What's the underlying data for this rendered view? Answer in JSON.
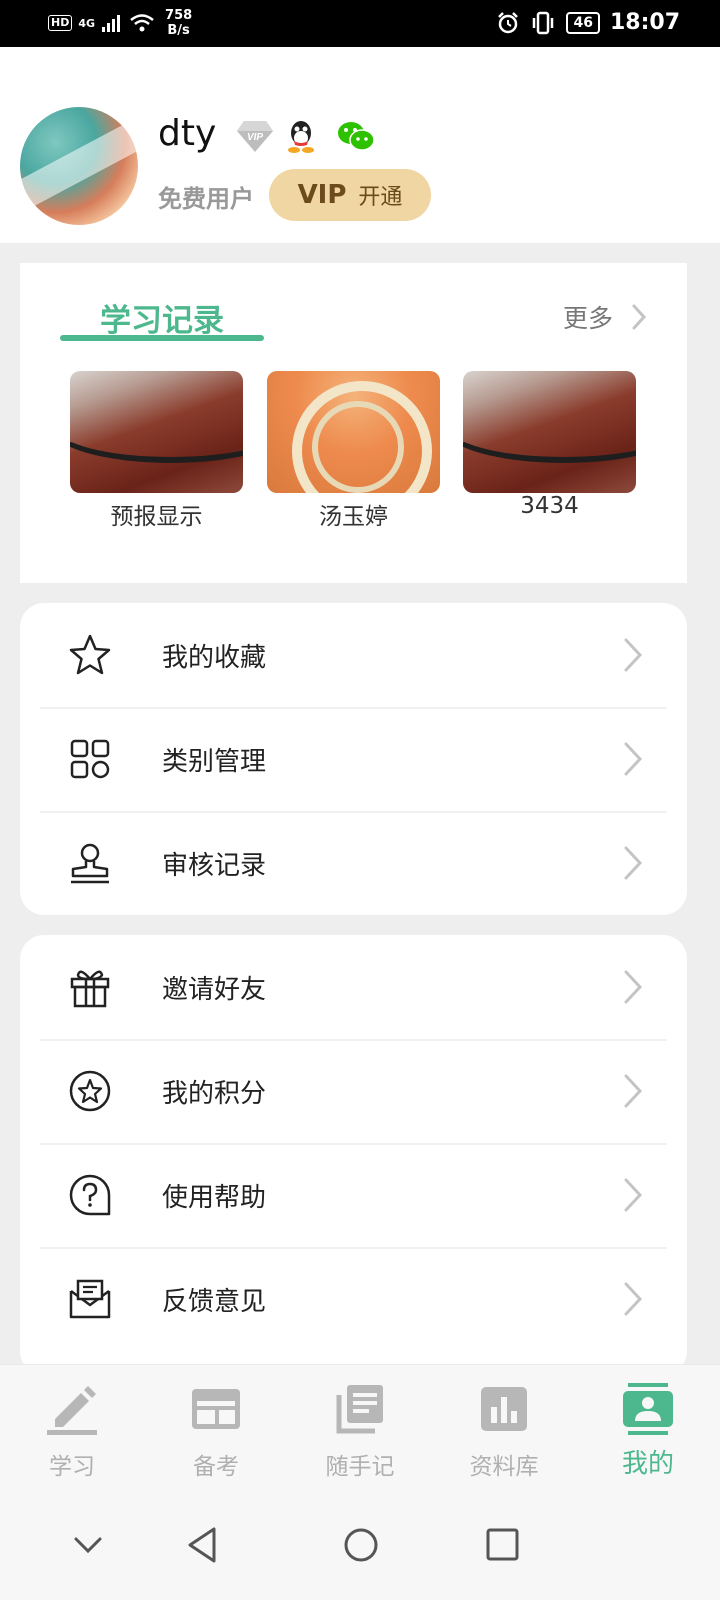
{
  "status_bar": {
    "hd": "HD",
    "signal": "4G",
    "speed_value": "758",
    "speed_unit": "B/s",
    "battery": "46",
    "time": "18:07"
  },
  "profile": {
    "username": "dty",
    "user_type": "免费用户",
    "vip_label": "VIP",
    "vip_action": "开通"
  },
  "study_record": {
    "title": "学习记录",
    "more": "更多",
    "items": [
      {
        "label": "预报显示"
      },
      {
        "label": "汤玉婷"
      },
      {
        "label": "3434"
      }
    ]
  },
  "menu_group_1": [
    {
      "label": "我的收藏",
      "icon": "star-icon"
    },
    {
      "label": "类别管理",
      "icon": "category-grid-icon"
    },
    {
      "label": "审核记录",
      "icon": "stamp-icon"
    }
  ],
  "menu_group_2": [
    {
      "label": "邀请好友",
      "icon": "gift-icon"
    },
    {
      "label": "我的积分",
      "icon": "points-star-icon"
    },
    {
      "label": "使用帮助",
      "icon": "help-icon"
    },
    {
      "label": "反馈意见",
      "icon": "feedback-mail-icon"
    }
  ],
  "tabs": [
    {
      "label": "学习",
      "icon": "pencil-icon"
    },
    {
      "label": "备考",
      "icon": "exam-card-icon"
    },
    {
      "label": "随手记",
      "icon": "notes-icon"
    },
    {
      "label": "资料库",
      "icon": "library-chart-icon"
    },
    {
      "label": "我的",
      "icon": "profile-icon",
      "active": true
    }
  ],
  "colors": {
    "accent": "#4db88e",
    "vip_bg": "#efd6a2",
    "vip_text": "#6b4a1b",
    "background": "#efeeef"
  }
}
